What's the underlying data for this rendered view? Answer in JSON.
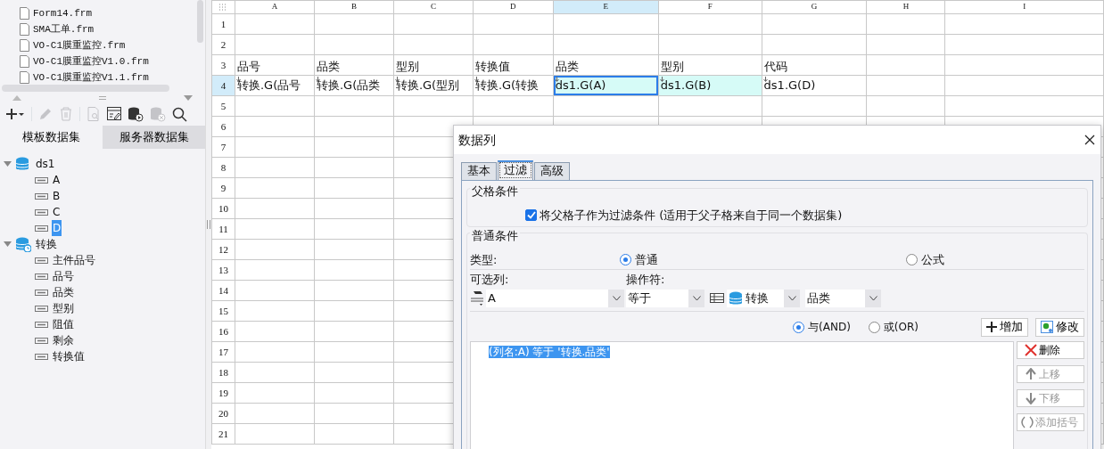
{
  "file_list": [
    {
      "name": "Form14.frm"
    },
    {
      "name": "SMA工单.frm"
    },
    {
      "name": "VO-C1膜重监控.frm"
    },
    {
      "name": "VO-C1膜重监控V1.0.frm"
    },
    {
      "name": "VO-C1膜重监控V1.1.frm"
    }
  ],
  "toolbar": [
    {
      "kind": "add",
      "disabled": false
    },
    {
      "kind": "edit",
      "disabled": true
    },
    {
      "kind": "delete",
      "disabled": true
    },
    {
      "kind": "preview",
      "disabled": true
    },
    {
      "kind": "params",
      "disabled": false
    },
    {
      "kind": "db-run",
      "disabled": false
    },
    {
      "kind": "db-remove",
      "disabled": true
    },
    {
      "kind": "search",
      "disabled": false
    }
  ],
  "dataset_tabs": [
    {
      "label": "模板数据集",
      "selected": true
    },
    {
      "label": "服务器数据集",
      "selected": false
    }
  ],
  "tree": [
    {
      "label": "ds1",
      "kind": "dataset",
      "expanded": true,
      "children": [
        {
          "label": "A",
          "selected": false
        },
        {
          "label": "B",
          "selected": false
        },
        {
          "label": "C",
          "selected": false
        },
        {
          "label": "D",
          "selected": true
        }
      ]
    },
    {
      "label": "转换",
      "kind": "server",
      "expanded": true,
      "children": [
        {
          "label": "主件品号",
          "selected": false
        },
        {
          "label": "品号",
          "selected": false
        },
        {
          "label": "品类",
          "selected": false
        },
        {
          "label": "型别",
          "selected": false
        },
        {
          "label": "阻值",
          "selected": false
        },
        {
          "label": "剩余",
          "selected": false
        },
        {
          "label": "转换值",
          "selected": false
        }
      ]
    }
  ],
  "sheet": {
    "columns": [
      {
        "label": "A",
        "selected": false
      },
      {
        "label": "B",
        "selected": false
      },
      {
        "label": "C",
        "selected": false
      },
      {
        "label": "D",
        "selected": false
      },
      {
        "label": "E",
        "selected": true
      },
      {
        "label": "F",
        "selected": false
      },
      {
        "label": "G",
        "selected": false
      },
      {
        "label": "H",
        "selected": false
      },
      {
        "label": "I",
        "selected": false
      }
    ],
    "rows": [
      {
        "label": "1",
        "selected": false
      },
      {
        "label": "2",
        "selected": false
      },
      {
        "label": "3",
        "selected": false,
        "cells": [
          {
            "text": "品号"
          },
          {
            "text": "品类"
          },
          {
            "text": "型别"
          },
          {
            "text": "转换值"
          },
          {
            "text": "品类"
          },
          {
            "text": "型别"
          },
          {
            "text": "代码"
          }
        ]
      },
      {
        "label": "4",
        "selected": true,
        "cells": [
          {
            "text": "转换.G(品号",
            "expand": true,
            "highlight": false,
            "selected": false
          },
          {
            "text": "转换.G(品类",
            "expand": true,
            "highlight": false,
            "selected": false
          },
          {
            "text": "转换.G(型别",
            "expand": true,
            "highlight": false,
            "selected": false
          },
          {
            "text": "转换.G(转换",
            "expand": true,
            "highlight": false,
            "selected": false
          },
          {
            "text": "ds1.G(A)",
            "expand": true,
            "highlight": true,
            "selected": true
          },
          {
            "text": "ds1.G(B)",
            "expand": true,
            "highlight": true,
            "selected": false
          },
          {
            "text": "ds1.G(D)",
            "expand": true,
            "highlight": false,
            "selected": false
          }
        ]
      },
      {
        "label": "5",
        "selected": false
      },
      {
        "label": "6",
        "selected": false
      },
      {
        "label": "7",
        "selected": false
      },
      {
        "label": "8",
        "selected": false
      },
      {
        "label": "9",
        "selected": false
      },
      {
        "label": "10",
        "selected": false
      },
      {
        "label": "11",
        "selected": false
      },
      {
        "label": "12",
        "selected": false
      },
      {
        "label": "13",
        "selected": false
      },
      {
        "label": "14",
        "selected": false
      },
      {
        "label": "15",
        "selected": false
      },
      {
        "label": "16",
        "selected": false
      },
      {
        "label": "17",
        "selected": false
      },
      {
        "label": "18",
        "selected": false
      },
      {
        "label": "19",
        "selected": false
      },
      {
        "label": "20",
        "selected": false
      },
      {
        "label": "21",
        "selected": false
      }
    ]
  },
  "dialog": {
    "title": "数据列",
    "tabs": [
      {
        "label": "基本",
        "selected": false
      },
      {
        "label": "过滤",
        "selected": true
      },
      {
        "label": "高级",
        "selected": false
      }
    ],
    "parent_group": {
      "title": "父格条件",
      "checkbox": {
        "label": "将父格子作为过滤条件 (适用于父子格来自于同一个数据集)",
        "checked": true
      }
    },
    "normal_group": {
      "title": "普通条件",
      "type_label": "类型:",
      "type_options": [
        {
          "label": "普通",
          "selected": true
        },
        {
          "label": "公式",
          "selected": false
        }
      ],
      "column_label": "可选列:",
      "operator_label": "操作符:",
      "column_value": "A",
      "operator_value": "等于",
      "dataset_value": "转换",
      "field_value": "品类",
      "logic_options": [
        {
          "label": "与(AND)",
          "selected": true
        },
        {
          "label": "或(OR)",
          "selected": false
        }
      ],
      "add_button": "增加",
      "modify_button": "修改",
      "conditions": [
        {
          "text": "(列名:A) 等于 '转换.品类'",
          "selected": true
        }
      ],
      "side_buttons": [
        {
          "label": "删除",
          "kind": "delete",
          "disabled": false
        },
        {
          "label": "上移",
          "kind": "up",
          "disabled": true
        },
        {
          "label": "下移",
          "kind": "down",
          "disabled": true
        },
        {
          "label": "添加括号",
          "kind": "brackets",
          "disabled": true
        }
      ]
    }
  }
}
